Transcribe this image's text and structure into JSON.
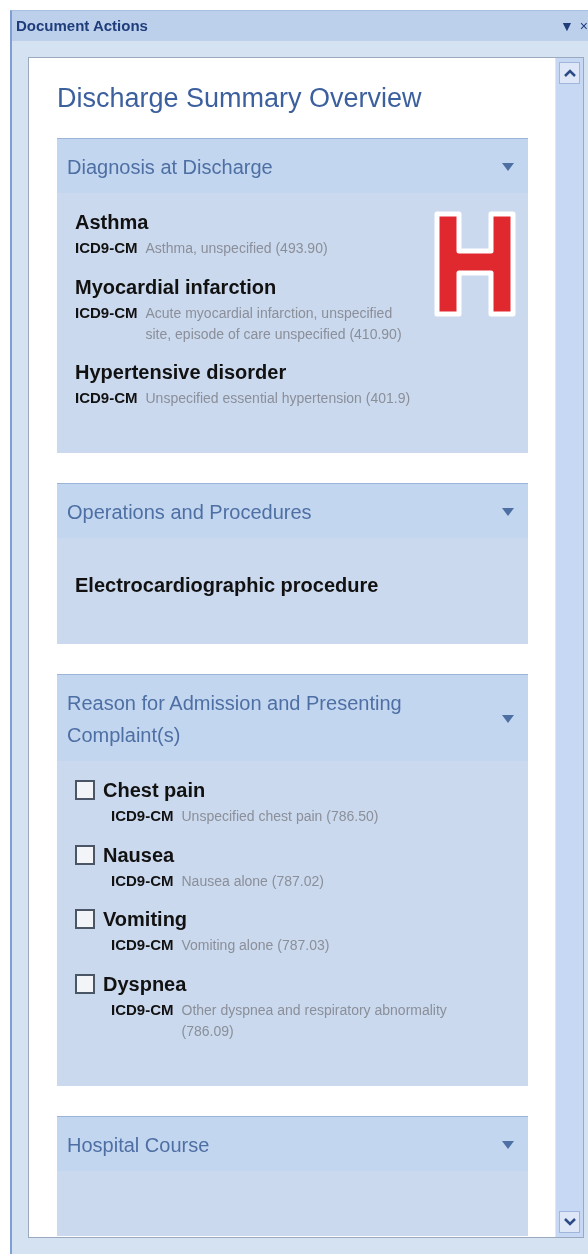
{
  "pane": {
    "title": "Document Actions",
    "menu_glyph": "▼",
    "close_glyph": "×"
  },
  "heading": "Discharge Summary Overview",
  "sections": [
    {
      "title": "Diagnosis at Discharge",
      "kind": "coded",
      "items": [
        {
          "name": "Asthma",
          "system": "ICD9-CM",
          "description": "Asthma, unspecified (493.90)"
        },
        {
          "name": "Myocardial infarction",
          "system": "ICD9-CM",
          "description": "Acute myocardial infarction, unspecified site, episode of care unspecified (410.90)"
        },
        {
          "name": "Hypertensive disorder",
          "system": "ICD9-CM",
          "description": "Unspecified essential hypertension (401.9)"
        }
      ]
    },
    {
      "title": "Operations and Procedures",
      "kind": "plain",
      "items": [
        {
          "name": "Electrocardiographic procedure"
        }
      ]
    },
    {
      "title": "Reason for Admission and Presenting Complaint(s)",
      "kind": "checklist",
      "items": [
        {
          "name": "Chest pain",
          "system": "ICD9-CM",
          "description": "Unspecified chest pain (786.50)",
          "checked": false
        },
        {
          "name": "Nausea",
          "system": "ICD9-CM",
          "description": "Nausea alone (787.02)",
          "checked": false
        },
        {
          "name": "Vomiting",
          "system": "ICD9-CM",
          "description": "Vomiting alone (787.03)",
          "checked": false
        },
        {
          "name": "Dyspnea",
          "system": "ICD9-CM",
          "description": "Other dyspnea and respiratory abnormality (786.09)",
          "checked": false
        }
      ]
    },
    {
      "title": "Hospital Course"
    }
  ]
}
